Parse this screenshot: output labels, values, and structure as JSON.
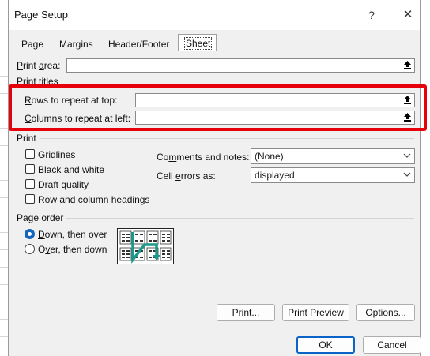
{
  "window": {
    "title": "Page Setup",
    "help_glyph": "?",
    "close_glyph": "✕"
  },
  "tabs": [
    "Page",
    "Margins",
    "Header/Footer",
    "Sheet"
  ],
  "print_area": {
    "label": "Print area:",
    "value": ""
  },
  "print_titles": {
    "heading": "Print titles",
    "rows_label": "Rows to repeat at top:",
    "rows_value": "",
    "columns_label": "Columns to repeat at left:",
    "columns_value": ""
  },
  "print": {
    "heading": "Print",
    "checkboxes": [
      {
        "label": "Gridlines",
        "checked": false
      },
      {
        "label": "Black and white",
        "checked": false
      },
      {
        "label": "Draft quality",
        "checked": false
      },
      {
        "label": "Row and column headings",
        "checked": false
      }
    ],
    "comments_label": "Comments and notes:",
    "comments_value": "(None)",
    "errors_label": "Cell errors as:",
    "errors_value": "displayed"
  },
  "page_order": {
    "heading": "Page order",
    "options": [
      {
        "label": "Down, then over",
        "selected": true
      },
      {
        "label": "Over, then down",
        "selected": false
      }
    ]
  },
  "buttons": {
    "print": "Print...",
    "print_preview": "Print Preview",
    "options": "Options...",
    "ok": "OK",
    "cancel": "Cancel"
  },
  "colors": {
    "highlight": "#e6000a",
    "accent": "#0a64c8",
    "order_arrow": "#1a9a8a"
  }
}
